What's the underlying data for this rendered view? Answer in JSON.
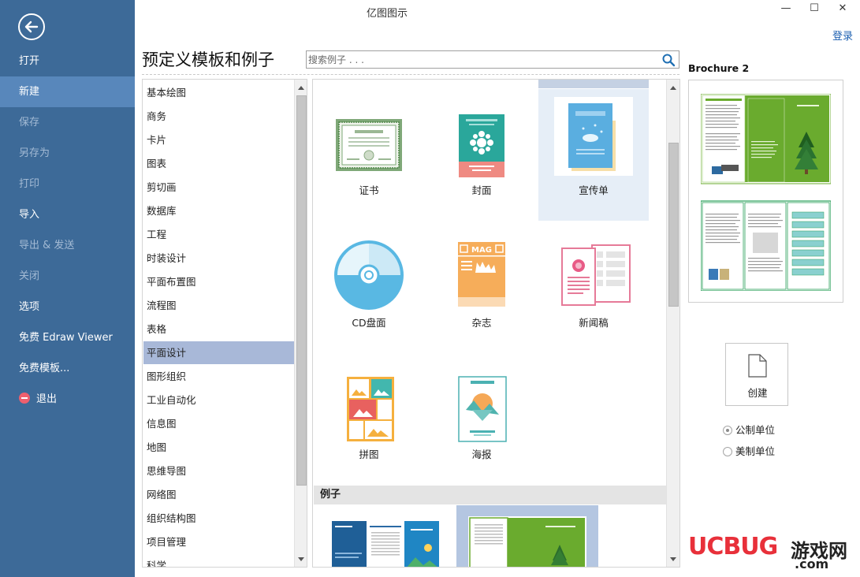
{
  "window": {
    "title": "亿图图示",
    "minimize": "—",
    "maximize": "☐",
    "close": "✕",
    "login": "登录"
  },
  "sidebar": {
    "items": [
      {
        "label": "打开"
      },
      {
        "label": "新建"
      },
      {
        "label": "保存"
      },
      {
        "label": "另存为"
      },
      {
        "label": "打印"
      },
      {
        "label": "导入"
      },
      {
        "label": "导出 & 发送"
      },
      {
        "label": "关闭"
      },
      {
        "label": "选项"
      },
      {
        "label": "免费 Edraw Viewer"
      },
      {
        "label": "免费模板..."
      },
      {
        "label": "退出"
      }
    ]
  },
  "main": {
    "title": "预定义模板和例子",
    "search_placeholder": "搜索例子 . . ."
  },
  "categories": [
    {
      "label": "基本绘图"
    },
    {
      "label": "商务"
    },
    {
      "label": "卡片"
    },
    {
      "label": "图表"
    },
    {
      "label": "剪切画"
    },
    {
      "label": "数据库"
    },
    {
      "label": "工程"
    },
    {
      "label": "时装设计"
    },
    {
      "label": "平面布置图"
    },
    {
      "label": "流程图"
    },
    {
      "label": "表格"
    },
    {
      "label": "平面设计"
    },
    {
      "label": "图形组织"
    },
    {
      "label": "工业自动化"
    },
    {
      "label": "信息图"
    },
    {
      "label": "地图"
    },
    {
      "label": "思维导图"
    },
    {
      "label": "网络图"
    },
    {
      "label": "组织结构图"
    },
    {
      "label": "项目管理"
    },
    {
      "label": "科学"
    }
  ],
  "templates": [
    {
      "label": "证书",
      "icon": "certificate-icon"
    },
    {
      "label": "封面",
      "icon": "cover-icon"
    },
    {
      "label": "宣传单",
      "icon": "flyer-icon"
    },
    {
      "label": "CD盘面",
      "icon": "cd-icon"
    },
    {
      "label": "杂志",
      "icon": "magazine-icon"
    },
    {
      "label": "新闻稿",
      "icon": "press-release-icon"
    },
    {
      "label": "拼图",
      "icon": "collage-icon"
    },
    {
      "label": "海报",
      "icon": "poster-icon"
    }
  ],
  "examples_header": "例子",
  "preview": {
    "title": "Brochure 2",
    "create_label": "创建",
    "units": [
      {
        "label": "公制单位",
        "checked": true
      },
      {
        "label": "美制单位",
        "checked": false
      }
    ]
  },
  "colors": {
    "sidebar": "#3d6a98",
    "sidebar_active": "#5887bb",
    "category_selected": "#a8b8d8",
    "template_selected": "#e6eef7",
    "brochure_green": "#6aab2e",
    "link": "#1c5fb0"
  },
  "watermark": {
    "brand": "UCBUG",
    "cn": "游戏网",
    "domain": ".com"
  }
}
